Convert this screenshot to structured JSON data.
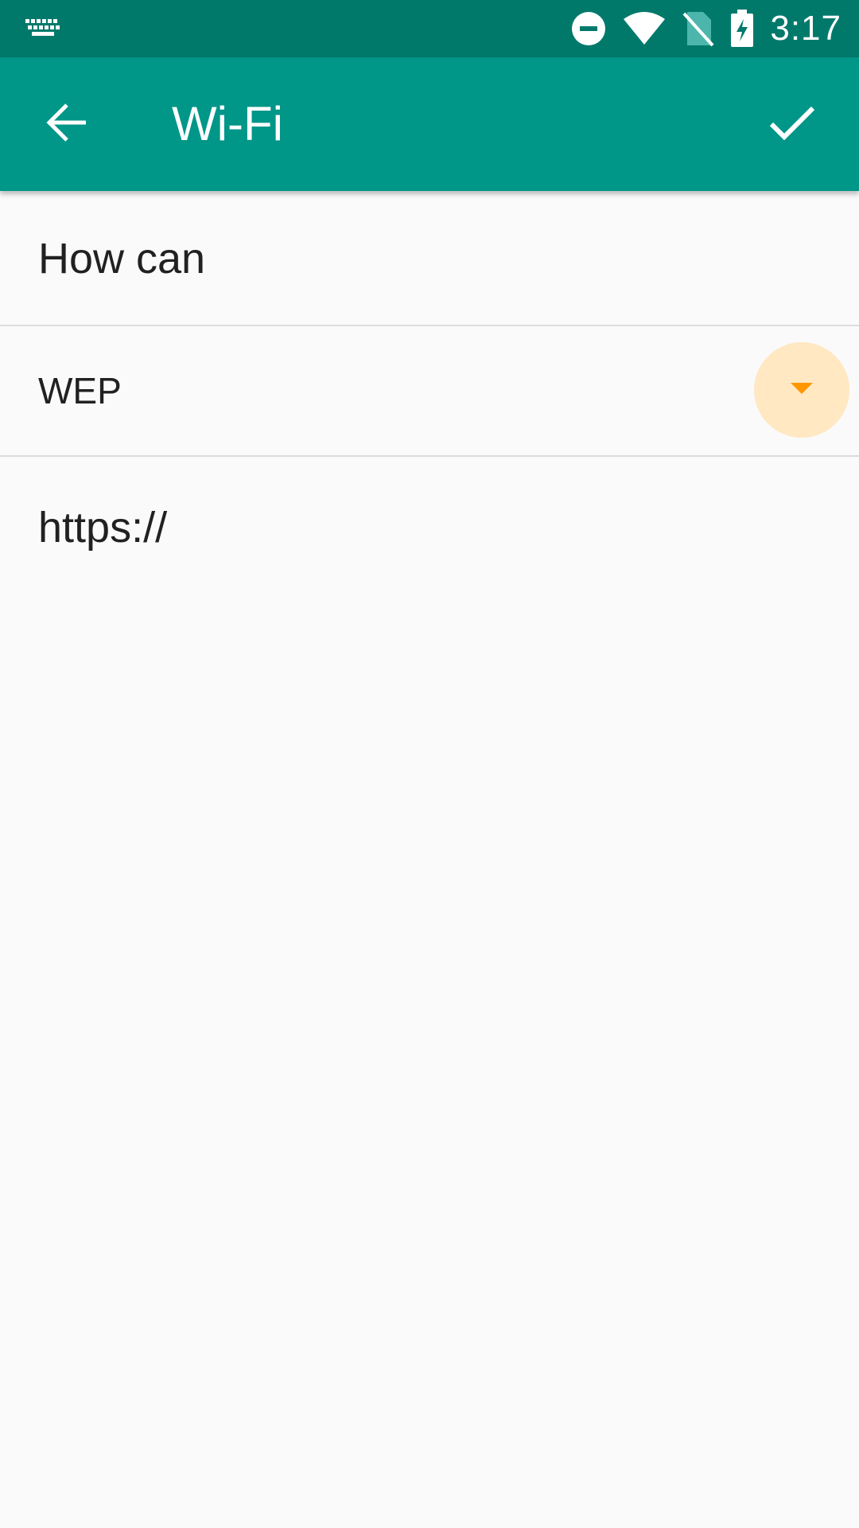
{
  "status_bar": {
    "time": "3:17",
    "icons": [
      "keyboard-icon",
      "do-not-disturb-icon",
      "wifi-icon",
      "no-sim-icon",
      "battery-charging-icon"
    ]
  },
  "app_bar": {
    "title": "Wi-Fi",
    "back_icon": "arrow-back-icon",
    "confirm_icon": "check-icon"
  },
  "form": {
    "network_name": "How can",
    "security_type": "WEP",
    "dropdown_icon": "dropdown-arrow-icon",
    "url": "https://"
  },
  "colors": {
    "status_bar": "#00796b",
    "app_bar": "#009688",
    "accent": "#ff9800",
    "dropdown_bg": "#ffe8c2",
    "background": "#fafafa"
  }
}
